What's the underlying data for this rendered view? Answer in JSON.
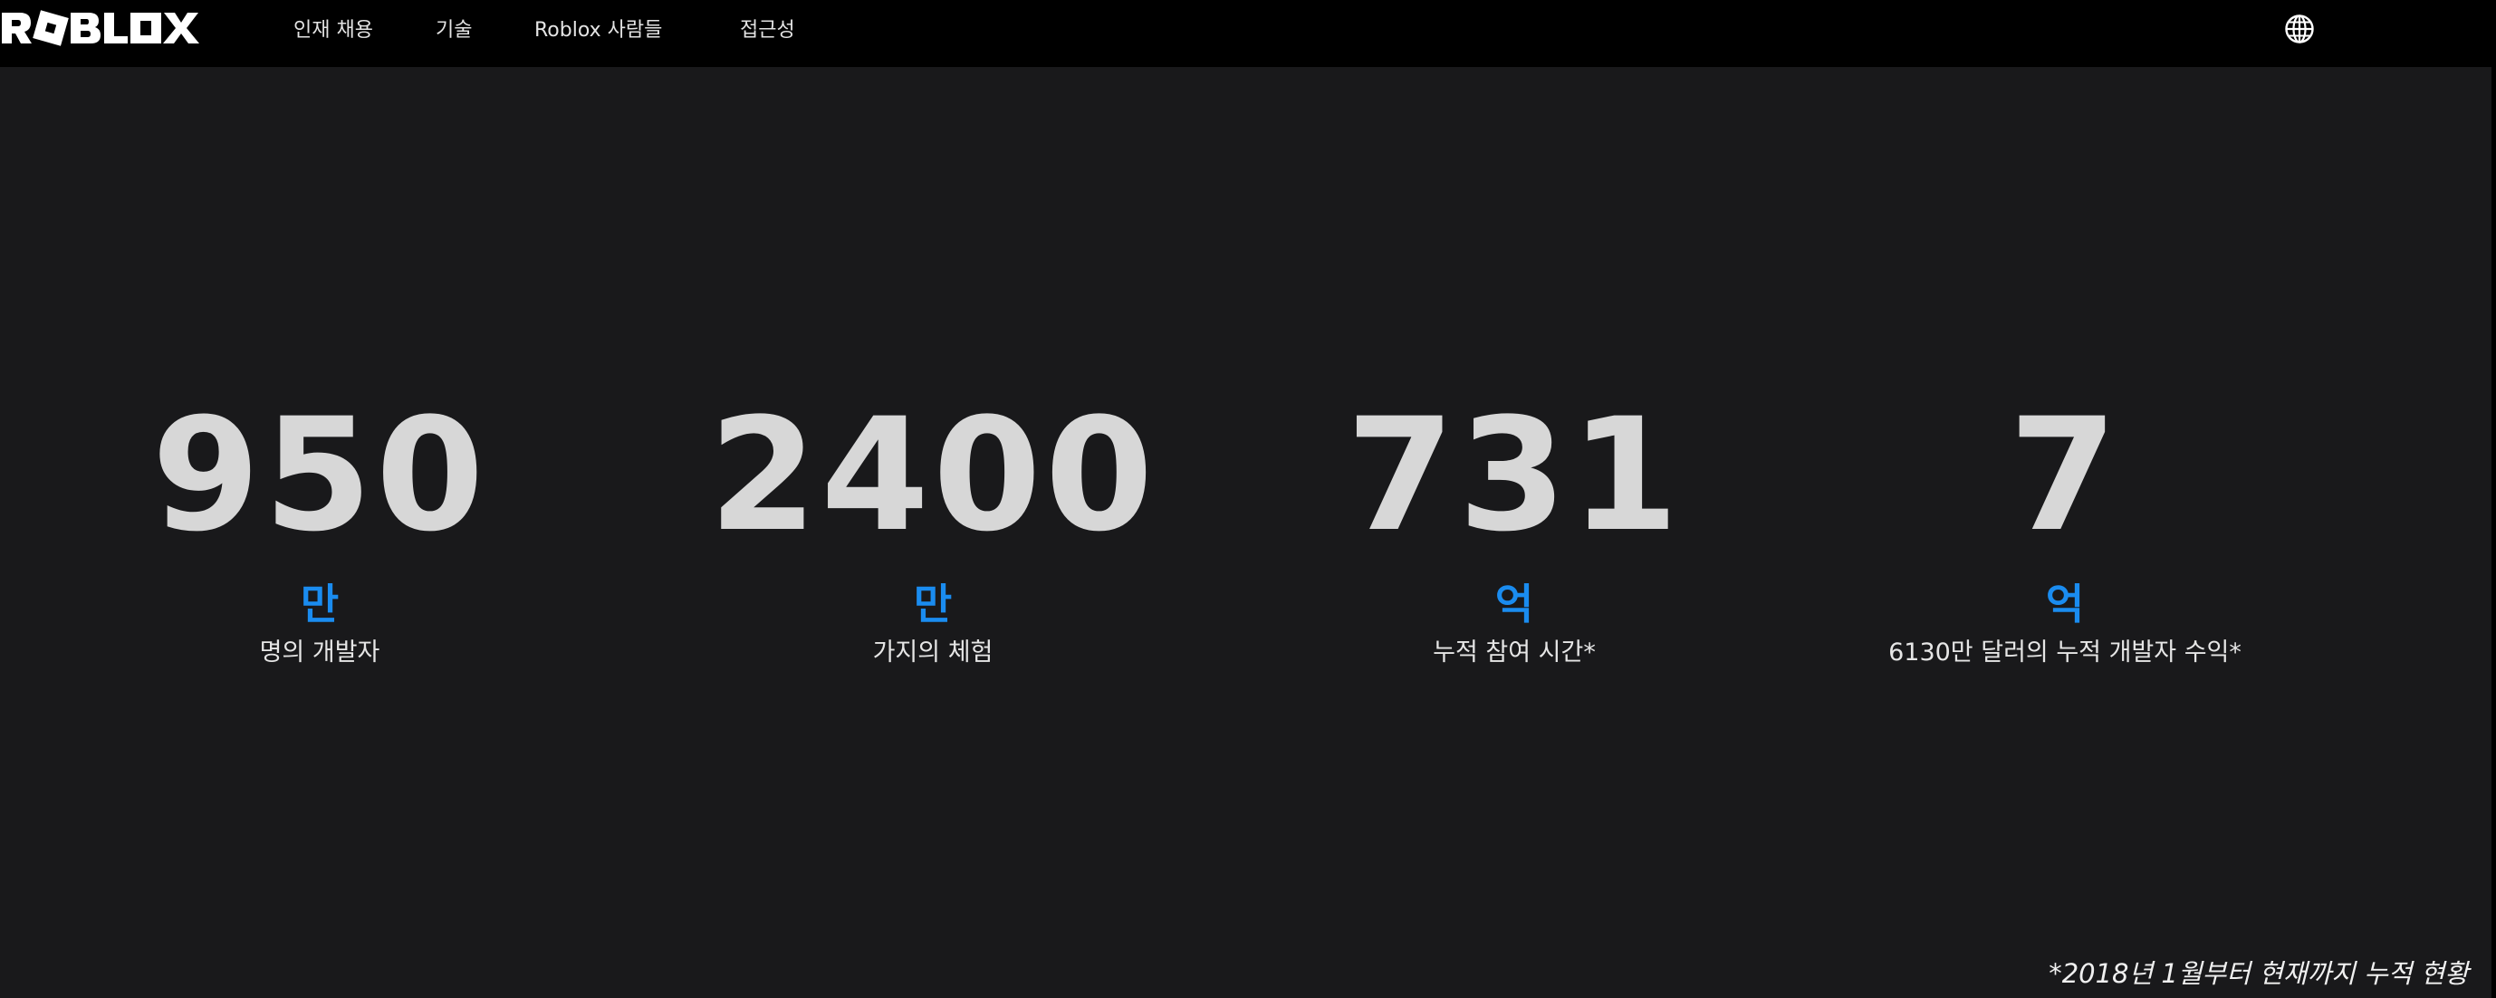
{
  "header": {
    "logo_text": "ROBLOX",
    "nav": [
      {
        "label": "인재 채용"
      },
      {
        "label": "기술"
      },
      {
        "label": "Roblox 사람들"
      },
      {
        "label": "접근성"
      }
    ],
    "language_icon": "globe-icon"
  },
  "stats": [
    {
      "number": "950",
      "unit": "만",
      "description": "명의 개발자"
    },
    {
      "number": "2400",
      "unit": "만",
      "description": "가지의 체험"
    },
    {
      "number": "731",
      "unit": "억",
      "description": "누적 참여 시간*"
    },
    {
      "number": "7",
      "unit": "억",
      "description": "6130만 달러의 누적 개발자 수익*"
    }
  ],
  "footnote": "*2018년 1월부터 현재까지 누적 현황",
  "colors": {
    "background": "#19191b",
    "topbar": "#000000",
    "accent": "#1a8cf0",
    "number": "#d7d7d7"
  }
}
